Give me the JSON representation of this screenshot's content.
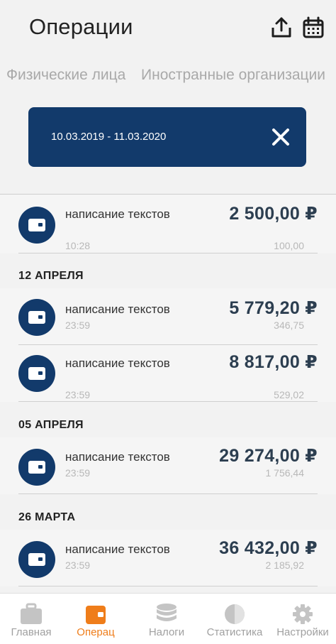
{
  "header": {
    "title": "Операции",
    "icons": [
      "share-icon",
      "calendar-icon"
    ]
  },
  "tabs": [
    {
      "label": "Физические лица"
    },
    {
      "label": "Иностранные организации"
    }
  ],
  "filter": {
    "date_range": "10.03.2019 - 11.03.2020",
    "close_icon": "close-icon"
  },
  "operations": [
    {
      "name": "написание текстов",
      "time": "10:28",
      "amount": "2 500,00 ₽",
      "fee": "100,00"
    },
    {
      "name": "написание текстов",
      "time": "23:59",
      "amount": "5 779,20 ₽",
      "fee": "346,75"
    },
    {
      "name": "написание текстов",
      "time": "23:59",
      "amount": "8 817,00 ₽",
      "fee": "529,02"
    },
    {
      "name": "написание текстов",
      "time": "23:59",
      "amount": "29 274,00 ₽",
      "fee": "1 756,44"
    },
    {
      "name": "написание текстов",
      "time": "23:59",
      "amount": "36 432,00 ₽",
      "fee": "2 185,92"
    }
  ],
  "sections": [
    {
      "label": "12 АПРЕЛЯ"
    },
    {
      "label": "05 АПРЕЛЯ"
    },
    {
      "label": "26 МАРТА"
    }
  ],
  "bottom_nav": [
    {
      "label": "Главная",
      "icon": "briefcase-icon"
    },
    {
      "label": "Операц",
      "icon": "wallet-icon",
      "active": true
    },
    {
      "label": "Налоги",
      "icon": "coins-icon"
    },
    {
      "label": "Статистика",
      "icon": "pie-chart-icon"
    },
    {
      "label": "Настройки",
      "icon": "gear-icon"
    }
  ],
  "colors": {
    "primary": "#123a6b",
    "accent": "#ef7d1a",
    "background": "#f2f2f2"
  }
}
